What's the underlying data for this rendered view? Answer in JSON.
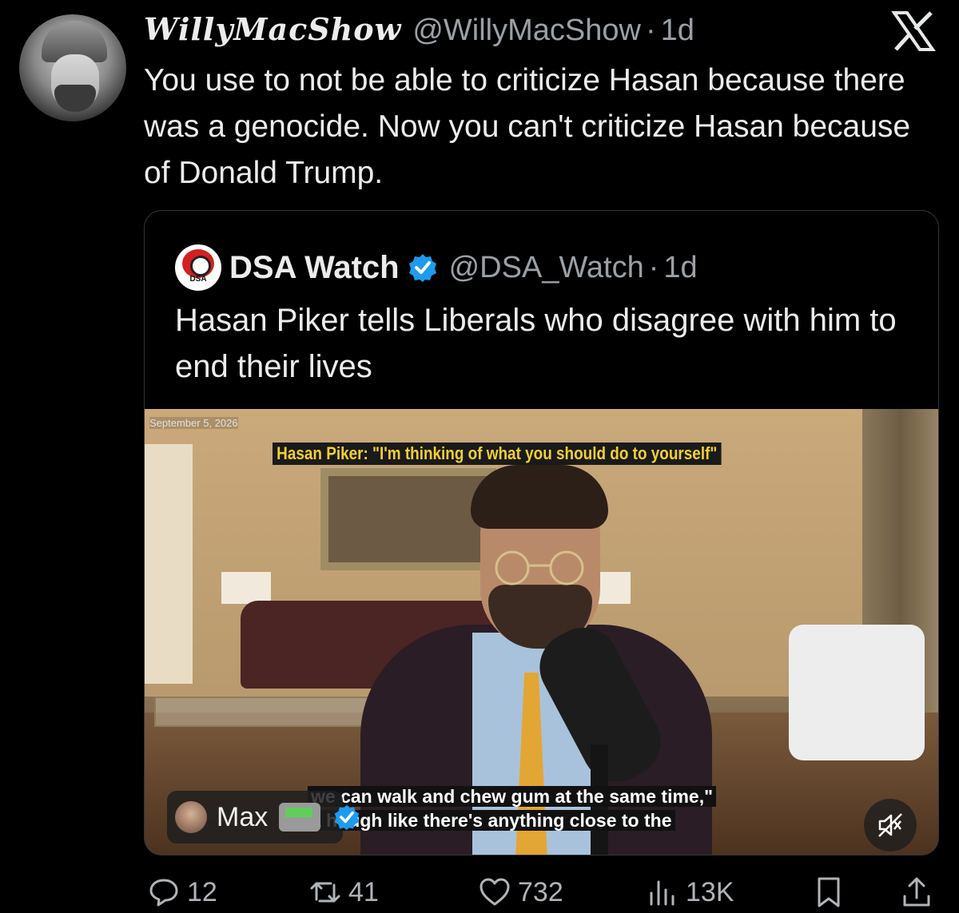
{
  "author": {
    "display_name": "WillyMacShow",
    "handle": "@WillyMacShow",
    "separator": "·",
    "time": "1d"
  },
  "tweet": {
    "text": "You use to not be able to criticize Hasan because there was a genocide. Now you can't criticize Hasan because of Donald Trump."
  },
  "quote": {
    "avatar_label": "DSA",
    "name": "DSA Watch",
    "handle": "@DSA_Watch",
    "separator": "·",
    "time": "1d",
    "text": "Hasan Piker tells Liberals who disagree with him to end their lives",
    "video": {
      "date_overlay": "September 5, 2026",
      "top_caption": "Hasan Piker: \"I'm thinking of what you should do to yourself\"",
      "subtitle_line1": "we can walk and chew gum at the same time,\"",
      "subtitle_line2": "a    hough like there's anything close to the",
      "creator_name": "Max"
    }
  },
  "actions": {
    "replies": "12",
    "reposts": "41",
    "likes": "732",
    "views": "13K"
  },
  "colors": {
    "background": "#000000",
    "text": "#e7e9ea",
    "muted": "#9aa0a6",
    "verified": "#1d9bf0",
    "caption_yellow": "#f4cf32"
  },
  "icons": [
    "x-logo-icon",
    "verified-badge-icon",
    "reply-icon",
    "repost-icon",
    "like-icon",
    "views-icon",
    "bookmark-icon",
    "share-icon",
    "mute-icon"
  ]
}
